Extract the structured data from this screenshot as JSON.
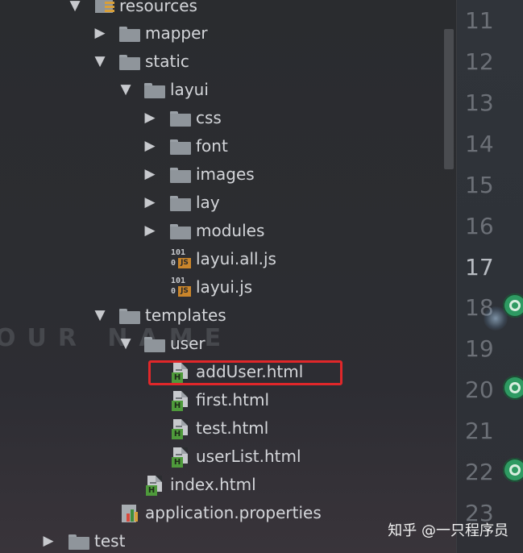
{
  "tree": {
    "items": [
      {
        "label": "resources",
        "type": "resources",
        "expanded": true
      },
      {
        "label": "mapper",
        "type": "folder",
        "expanded": false
      },
      {
        "label": "static",
        "type": "folder",
        "expanded": true
      },
      {
        "label": "layui",
        "type": "folder",
        "expanded": true
      },
      {
        "label": "css",
        "type": "folder",
        "expanded": false
      },
      {
        "label": "font",
        "type": "folder",
        "expanded": false
      },
      {
        "label": "images",
        "type": "folder",
        "expanded": false
      },
      {
        "label": "lay",
        "type": "folder",
        "expanded": false
      },
      {
        "label": "modules",
        "type": "folder",
        "expanded": false
      },
      {
        "label": "layui.all.js",
        "type": "js"
      },
      {
        "label": "layui.js",
        "type": "js"
      },
      {
        "label": "templates",
        "type": "folder",
        "expanded": true
      },
      {
        "label": "user",
        "type": "folder",
        "expanded": true
      },
      {
        "label": "addUser.html",
        "type": "html",
        "highlighted": true
      },
      {
        "label": "first.html",
        "type": "html"
      },
      {
        "label": "test.html",
        "type": "html"
      },
      {
        "label": "userList.html",
        "type": "html"
      },
      {
        "label": "index.html",
        "type": "html"
      },
      {
        "label": "application.properties",
        "type": "properties"
      },
      {
        "label": "test",
        "type": "folder",
        "expanded": false
      }
    ],
    "js_icon_digits_top": "101",
    "js_icon_digits_bottom": "0",
    "js_icon_badge": "JS",
    "html_icon_badge": "H"
  },
  "background_text": "OUR NAME",
  "gutter": {
    "line_numbers": [
      "11",
      "12",
      "13",
      "14",
      "15",
      "16",
      "17",
      "18",
      "19",
      "20",
      "21",
      "22",
      "23"
    ],
    "current_line": "17"
  },
  "watermark": "知乎 @一只程序员",
  "colors": {
    "highlight_border": "#e0272a",
    "text": "#d4d6da",
    "html_badge": "#4e9a3b",
    "js_badge": "#c9852b",
    "marker": "#2e9a62"
  }
}
